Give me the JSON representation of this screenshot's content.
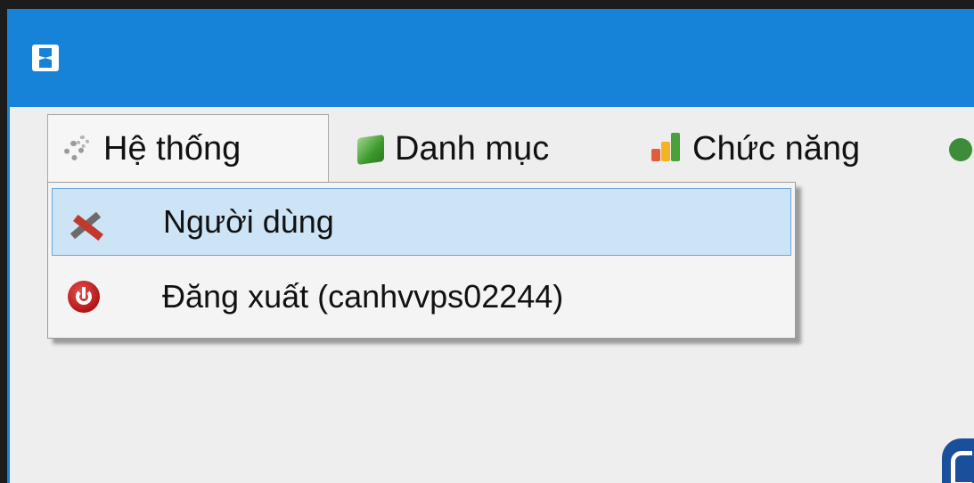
{
  "window": {
    "accent_color": "#1682d8"
  },
  "menubar": {
    "items": [
      {
        "label": "Hệ thống",
        "icon": "gear-icon",
        "state": "open"
      },
      {
        "label": "Danh mục",
        "icon": "cube-icon"
      },
      {
        "label": "Chức năng",
        "icon": "bar-chart-icon"
      }
    ]
  },
  "dropdown": {
    "items": [
      {
        "label": "Người dùng",
        "icon": "tools-icon",
        "state": "highlighted"
      },
      {
        "label": "Đăng xuất (canhvvps02244)",
        "icon": "power-icon"
      }
    ]
  }
}
